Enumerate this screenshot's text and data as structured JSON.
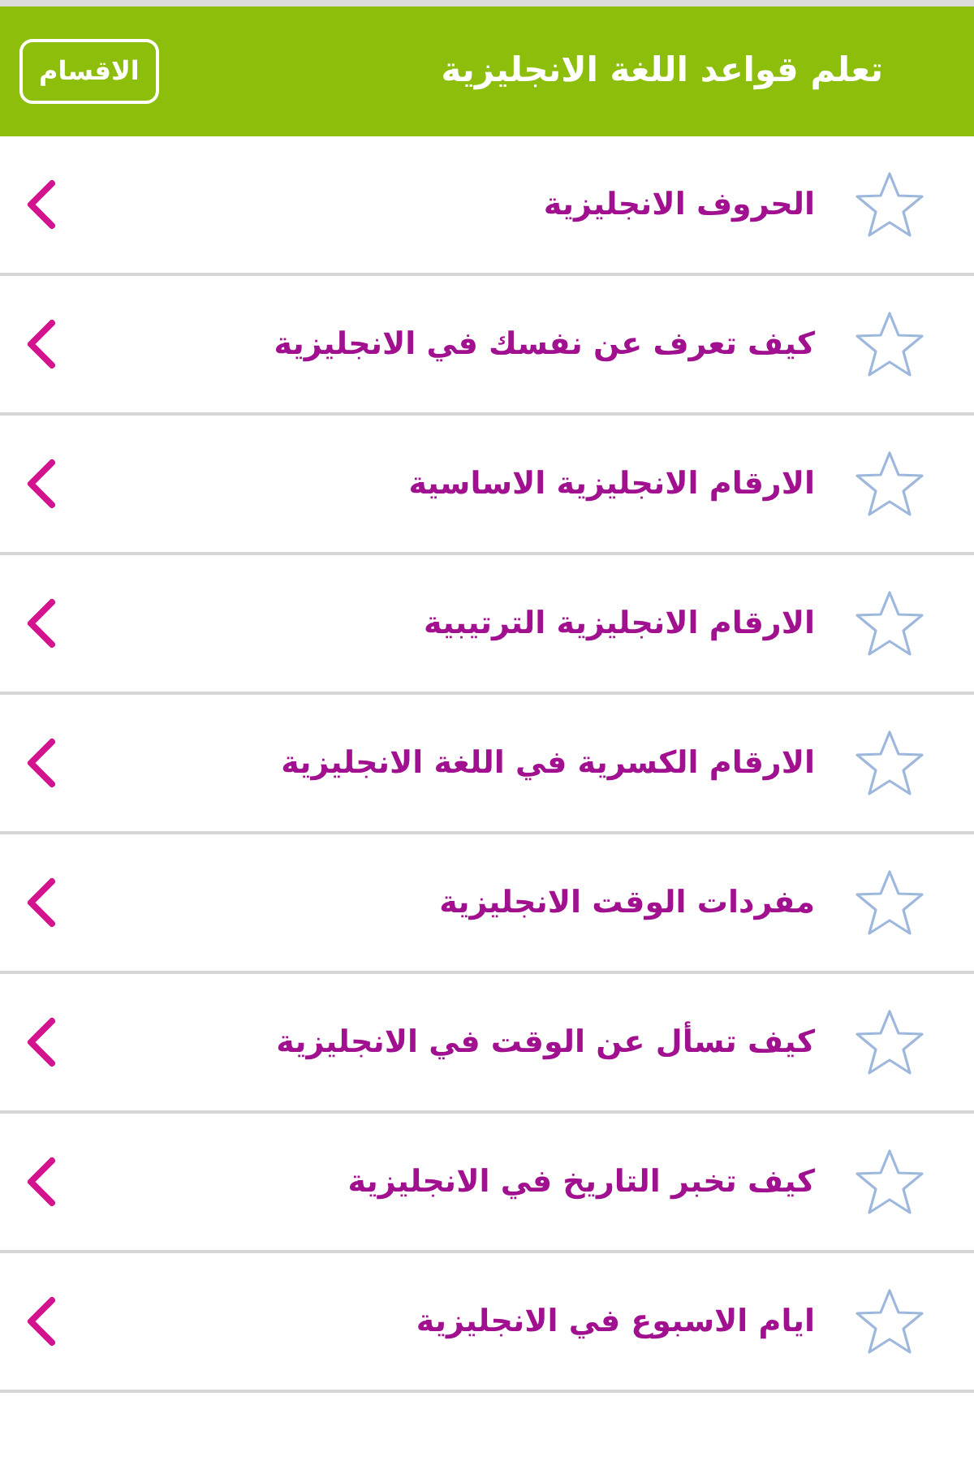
{
  "header": {
    "title": "تعلم قواعد اللغة الانجليزية",
    "sections_button": "الاقسام"
  },
  "items": [
    {
      "title": "الحروف الانجليزية",
      "favorite": false
    },
    {
      "title": "كيف تعرف عن نفسك في الانجليزية",
      "favorite": false
    },
    {
      "title": "الارقام الانجليزية الاساسية",
      "favorite": false
    },
    {
      "title": "الارقام الانجليزية الترتيبية",
      "favorite": false
    },
    {
      "title": "الارقام الكسرية في اللغة الانجليزية",
      "favorite": false
    },
    {
      "title": "مفردات الوقت الانجليزية",
      "favorite": false
    },
    {
      "title": "كيف تسأل عن الوقت في الانجليزية",
      "favorite": false
    },
    {
      "title": "كيف تخبر التاريخ في الانجليزية",
      "favorite": false
    },
    {
      "title": "ايام الاسبوع في الانجليزية",
      "favorite": false
    }
  ]
}
